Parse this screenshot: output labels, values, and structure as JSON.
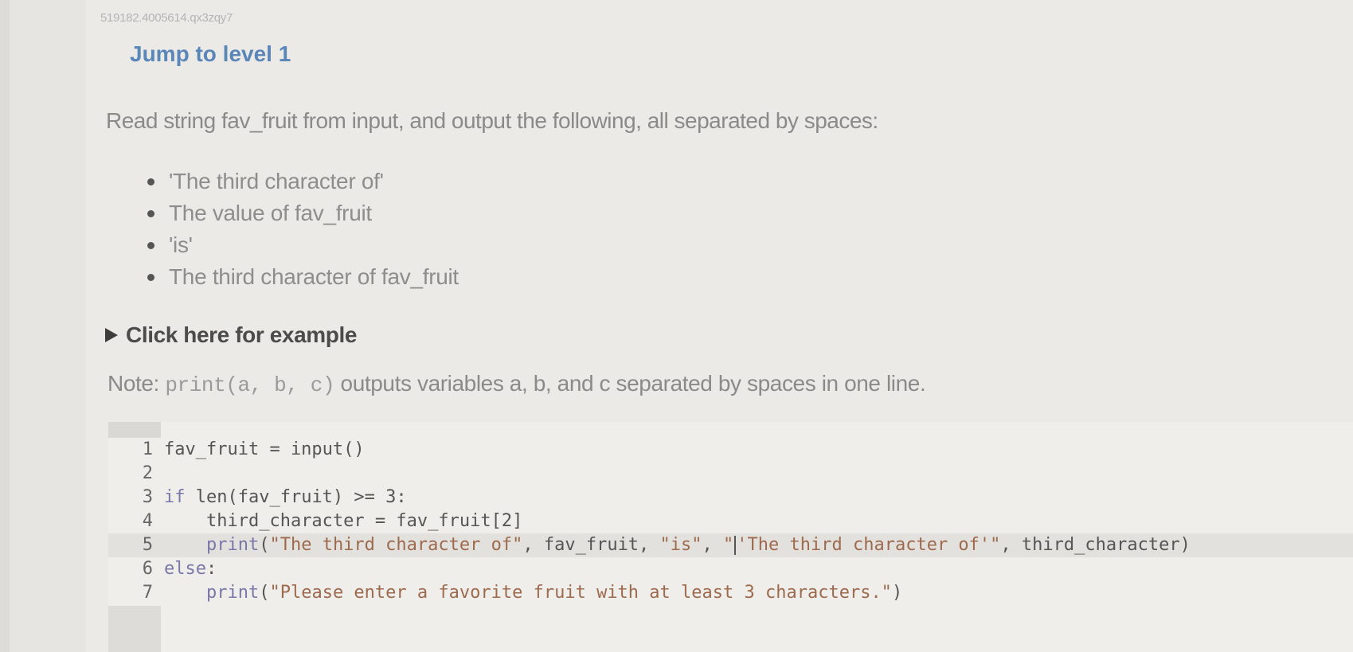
{
  "activity_id": "519182.4005614.qx3zqy7",
  "jump_link": "Jump to level 1",
  "prompt": "Read string fav_fruit from input, and output the following, all separated by spaces:",
  "bullets": [
    "'The third character of'",
    "The value of fav_fruit",
    "'is'",
    "The third character of fav_fruit"
  ],
  "example_toggle": "Click here for example",
  "note": {
    "prefix": "Note: ",
    "code": "print(a, b, c)",
    "suffix": " outputs variables a, b, and c separated by spaces in one line."
  },
  "editor": {
    "lines": [
      {
        "num": "1",
        "indent": "",
        "tokens": [
          {
            "t": "fav_fruit = input()",
            "c": "fn"
          }
        ]
      },
      {
        "num": "2",
        "indent": "",
        "tokens": []
      },
      {
        "num": "3",
        "indent": "",
        "tokens": [
          {
            "t": "if",
            "c": "kw"
          },
          {
            "t": " len(fav_fruit) >= 3:",
            "c": "fn"
          }
        ]
      },
      {
        "num": "4",
        "indent": "    ",
        "tokens": [
          {
            "t": "third_character = fav_fruit[2]",
            "c": "fn"
          }
        ]
      },
      {
        "num": "5",
        "indent": "    ",
        "active": true,
        "tokens": [
          {
            "t": "print",
            "c": "kw"
          },
          {
            "t": "(",
            "c": "fn"
          },
          {
            "t": "\"The third character of\"",
            "c": "str"
          },
          {
            "t": ", fav_fruit, ",
            "c": "fn"
          },
          {
            "t": "\"is\"",
            "c": "str"
          },
          {
            "t": ", ",
            "c": "fn"
          },
          {
            "t": "\"",
            "c": "str"
          },
          {
            "t": "|cursor|",
            "c": "cursor"
          },
          {
            "t": "'The third character of'\"",
            "c": "str"
          },
          {
            "t": ", third_character)",
            "c": "fn"
          }
        ]
      },
      {
        "num": "6",
        "indent": "",
        "tokens": [
          {
            "t": "else",
            "c": "kw"
          },
          {
            "t": ":",
            "c": "fn"
          }
        ]
      },
      {
        "num": "7",
        "indent": "    ",
        "tokens": [
          {
            "t": "print",
            "c": "kw"
          },
          {
            "t": "(",
            "c": "fn"
          },
          {
            "t": "\"Please enter a favorite fruit with at least 3 characters.\"",
            "c": "str"
          },
          {
            "t": ")",
            "c": "fn"
          }
        ]
      }
    ]
  },
  "colors": {
    "link": "#5b86b8",
    "keyword": "#7a78a8",
    "string": "#9e6a4e",
    "text": "#8a8a88"
  }
}
